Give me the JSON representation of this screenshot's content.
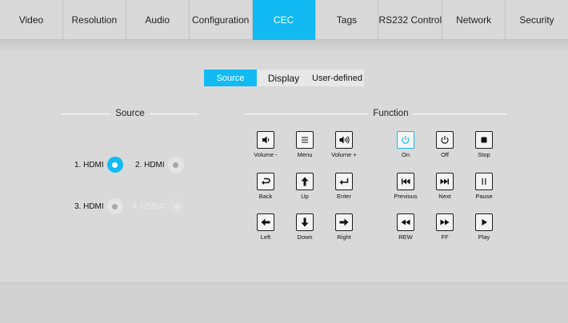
{
  "nav": {
    "tabs": [
      {
        "label": "Video"
      },
      {
        "label": "Resolution"
      },
      {
        "label": "Audio"
      },
      {
        "label": "Configuration"
      },
      {
        "label": "CEC",
        "active": true
      },
      {
        "label": "Tags"
      },
      {
        "label": "RS232 Control"
      },
      {
        "label": "Network"
      },
      {
        "label": "Security"
      }
    ]
  },
  "subtabs": {
    "source": "Source",
    "display": "Display",
    "user_defined": "User-defined",
    "active": "Source"
  },
  "source": {
    "title": "Source",
    "items": [
      {
        "label": "1. HDMI",
        "state": "selected"
      },
      {
        "label": "2. HDMI",
        "state": "unselected"
      },
      {
        "label": "3. HDMI",
        "state": "unselected"
      },
      {
        "label": "4. USB-C",
        "state": "disabled"
      }
    ]
  },
  "function": {
    "title": "Function",
    "buttons": {
      "volume_minus": {
        "label": "Volume -",
        "icon": "volume-down-icon"
      },
      "menu": {
        "label": "Menu",
        "icon": "menu-icon"
      },
      "volume_plus": {
        "label": "Volume +",
        "icon": "volume-up-icon"
      },
      "on": {
        "label": "On",
        "icon": "power-icon",
        "color": "#12baf3"
      },
      "off": {
        "label": "Off",
        "icon": "power-icon"
      },
      "stop": {
        "label": "Stop",
        "icon": "stop-icon"
      },
      "back": {
        "label": "Back",
        "icon": "back-icon"
      },
      "up": {
        "label": "Up",
        "icon": "arrow-up-icon"
      },
      "enter": {
        "label": "Enter",
        "icon": "enter-icon"
      },
      "previous": {
        "label": "Previous",
        "icon": "skip-previous-icon"
      },
      "next": {
        "label": "Next",
        "icon": "skip-next-icon"
      },
      "pause": {
        "label": "Pause",
        "icon": "pause-icon"
      },
      "left": {
        "label": "Left",
        "icon": "arrow-left-icon"
      },
      "down": {
        "label": "Down",
        "icon": "arrow-down-icon"
      },
      "right": {
        "label": "Right",
        "icon": "arrow-right-icon"
      },
      "rew": {
        "label": "REW",
        "icon": "rewind-icon"
      },
      "ff": {
        "label": "FF",
        "icon": "fast-forward-icon"
      },
      "play": {
        "label": "Play",
        "icon": "play-icon"
      }
    }
  },
  "colors": {
    "accent": "#12baf3",
    "background": "#d9d9d9"
  }
}
